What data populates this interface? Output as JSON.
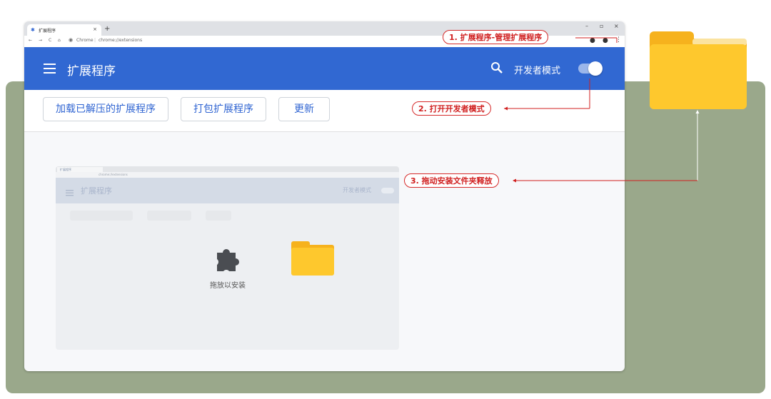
{
  "browser": {
    "tab_title": "扩展程序",
    "tab_close": "×",
    "new_tab": "+",
    "address_site": "Chrome",
    "address_url": "chrome://extensions",
    "window_minimize": "–",
    "window_restore": "▫",
    "window_close": "×"
  },
  "header": {
    "title": "扩展程序",
    "dev_mode_label": "开发者模式",
    "dev_mode_on": true
  },
  "toolbar": {
    "load_unpacked": "加载已解压的扩展程序",
    "pack": "打包扩展程序",
    "update": "更新"
  },
  "drop_zone": {
    "label": "拖放以安装"
  },
  "mini_screenshot": {
    "tab_title": "扩展程序",
    "address_url": "chrome://extensions",
    "header_title": "扩展程序",
    "dev_mode_label": "开发者模式"
  },
  "callouts": {
    "step1": "1. 扩展程序-管理扩展程序",
    "step2": "2. 打开开发者模式",
    "step3": "3. 拖动安装文件夹释放"
  },
  "colors": {
    "header": "#3168d2",
    "backdrop": "#9aa88b",
    "callout": "#d01f1f",
    "folder": "#fec82d"
  }
}
